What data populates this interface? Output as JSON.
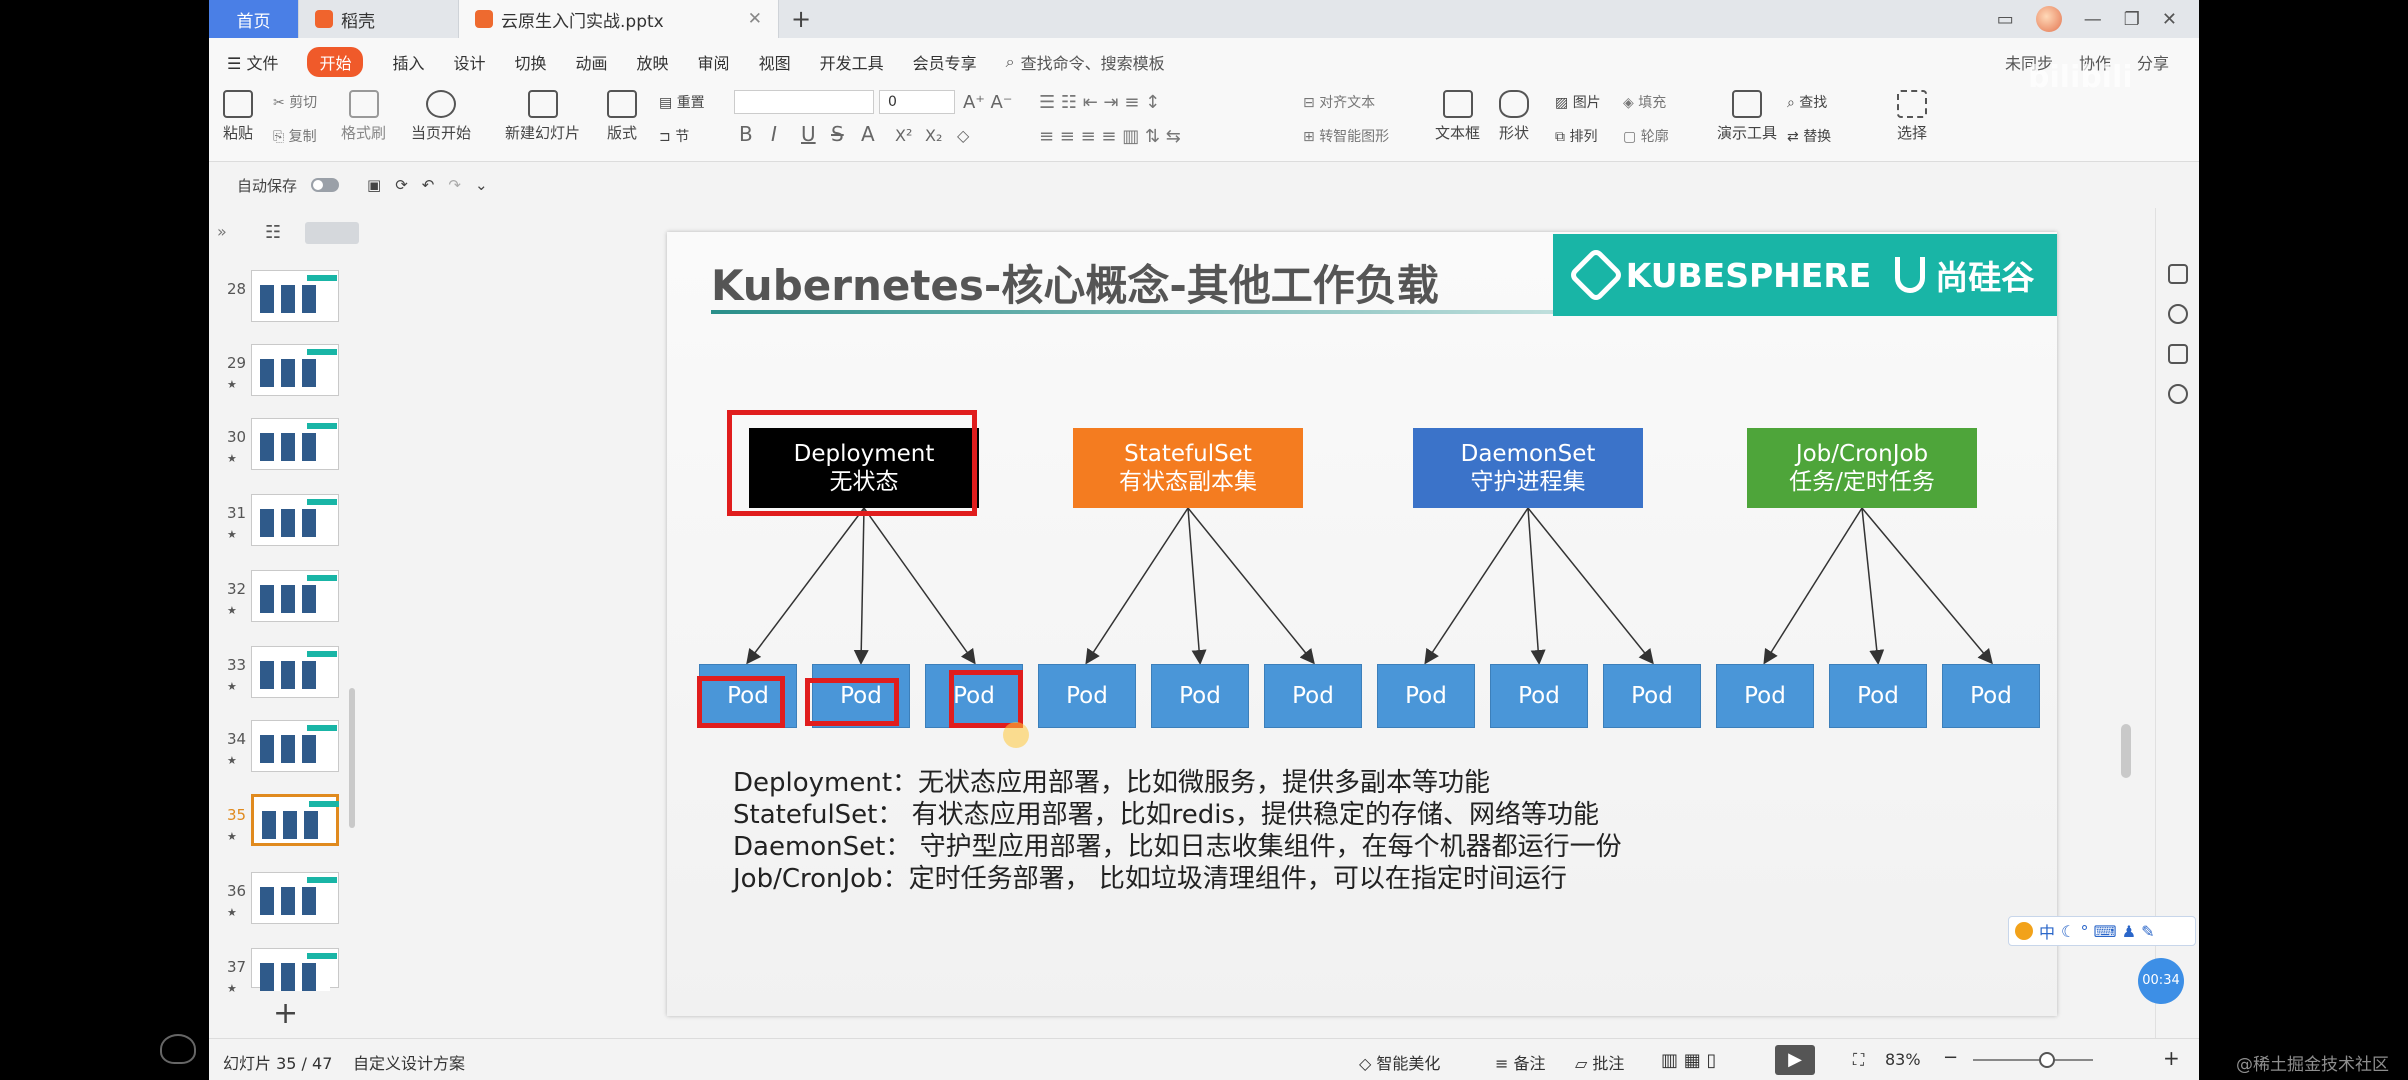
{
  "tabs": {
    "home": "首页",
    "docer": "稻壳",
    "active_file": "云原生入门实战.pptx",
    "new_tab": "+"
  },
  "menu": {
    "file": "文件",
    "items": [
      "开始",
      "插入",
      "设计",
      "切换",
      "动画",
      "放映",
      "审阅",
      "视图",
      "开发工具",
      "会员专享"
    ],
    "search_placeholder": "查找命令、搜索模板",
    "right": [
      "未同步",
      "协作",
      "分享"
    ]
  },
  "ribbon": {
    "paste": "粘贴",
    "cut": "剪切",
    "copy": "复制",
    "format_painter": "格式刷",
    "from_current": "当页开始",
    "new_slide": "新建幻灯片",
    "layout": "版式",
    "reset": "重置",
    "section": "节",
    "font_size": "0",
    "align_text": "对齐文本",
    "smartart": "转智能图形",
    "textbox": "文本框",
    "shape": "形状",
    "picture": "图片",
    "fill": "填充",
    "arrange": "排列",
    "outline": "轮廓",
    "presenter_tools": "演示工具",
    "find": "查找",
    "replace": "替换",
    "select": "选择"
  },
  "quickbar": {
    "autosave": "自动保存"
  },
  "thumbnails": [
    {
      "num": "28",
      "star": ""
    },
    {
      "num": "29",
      "star": "★"
    },
    {
      "num": "30",
      "star": "★"
    },
    {
      "num": "31",
      "star": "★"
    },
    {
      "num": "32",
      "star": "★"
    },
    {
      "num": "33",
      "star": "★"
    },
    {
      "num": "34",
      "star": "★"
    },
    {
      "num": "35",
      "star": "★",
      "selected": true
    },
    {
      "num": "36",
      "star": "★"
    },
    {
      "num": "37",
      "star": "★"
    }
  ],
  "add_slide": "+",
  "slide": {
    "title": "Kubernetes-核心概念-其他工作负载",
    "brand_kubesphere": "KUBESPHERE",
    "brand_atguigu": "尚硅谷",
    "workloads": [
      {
        "name": "Deployment",
        "subtitle": "无状态",
        "color": "#000000"
      },
      {
        "name": "StatefulSet",
        "subtitle": "有状态副本集",
        "color": "#f47c20"
      },
      {
        "name": "DaemonSet",
        "subtitle": "守护进程集",
        "color": "#3b73c9"
      },
      {
        "name": "Job/CronJob",
        "subtitle": "任务/定时任务",
        "color": "#4ea53a"
      }
    ],
    "pod_label": "Pod",
    "pod_count": 12,
    "descriptions": [
      "Deployment：无状态应用部署，比如微服务，提供多副本等功能",
      "StatefulSet：  有状态应用部署，比如redis，提供稳定的存储、网络等功能",
      "DaemonSet：  守护型应用部署，比如日志收集组件，在每个机器都运行一份",
      "Job/CronJob：定时任务部署，   比如垃圾清理组件，可以在指定时间运行"
    ]
  },
  "statusbar": {
    "slide_counter": "幻灯片 35 / 47",
    "design_scheme": "自定义设计方案",
    "smart_beautify": "智能美化",
    "notes": "备注",
    "comments": "批注",
    "zoom": "83%"
  },
  "overlay": {
    "ime_label": "中",
    "timer": "00:34",
    "watermark": "@稀土掘金技术社区",
    "bili": "bilibili"
  },
  "colors": {
    "accent_orange": "#f05a2a",
    "teal_brand": "#19b5a6",
    "pod_blue": "#4a96d8",
    "highlight_red": "#e01d1d"
  }
}
